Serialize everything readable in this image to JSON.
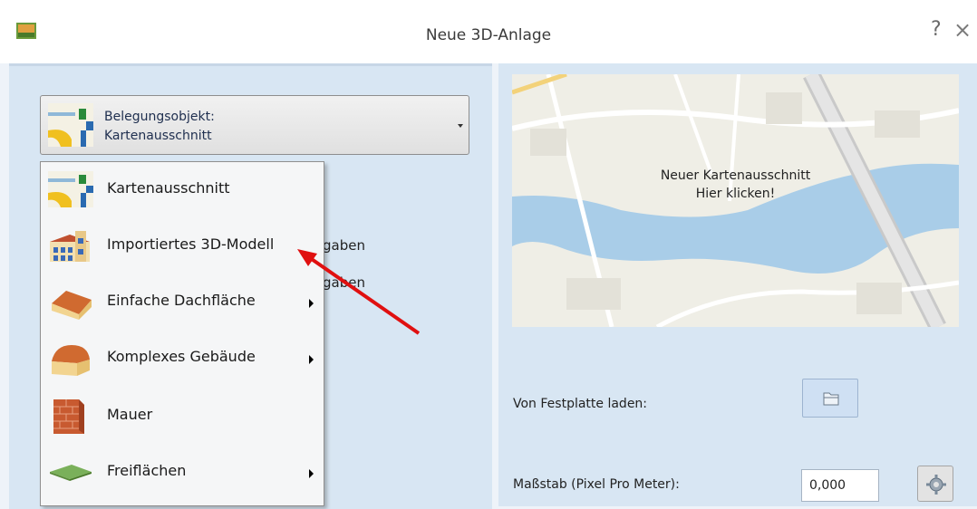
{
  "window": {
    "title": "Neue 3D-Anlage",
    "help": "?",
    "close": "×"
  },
  "dropdown": {
    "line1": "Belegungsobjekt:",
    "line2": "Kartenausschnitt"
  },
  "menu": {
    "items": [
      {
        "label": "Kartenausschnitt",
        "icon": "map-section-icon",
        "submenu": false
      },
      {
        "label": "Importiertes 3D-Modell",
        "icon": "3d-model-icon",
        "submenu": false
      },
      {
        "label": "Einfache Dachfläche",
        "icon": "simple-roof-icon",
        "submenu": true
      },
      {
        "label": "Komplexes Gebäude",
        "icon": "complex-building-icon",
        "submenu": true
      },
      {
        "label": "Mauer",
        "icon": "wall-icon",
        "submenu": false
      },
      {
        "label": "Freiflächen",
        "icon": "open-space-icon",
        "submenu": true
      }
    ]
  },
  "behind_menu": {
    "text1": "gaben",
    "text2": "gaben"
  },
  "map_preview": {
    "line1": "Neuer Kartenausschnitt",
    "line2": "Hier klicken!"
  },
  "load": {
    "label": "Von Festplatte laden:"
  },
  "scale": {
    "label": "Maßstab (Pixel Pro Meter):",
    "value": "0,000"
  },
  "colors": {
    "panel": "#d8e6f3",
    "arrow": "#e01010",
    "water": "#a9cde8"
  }
}
